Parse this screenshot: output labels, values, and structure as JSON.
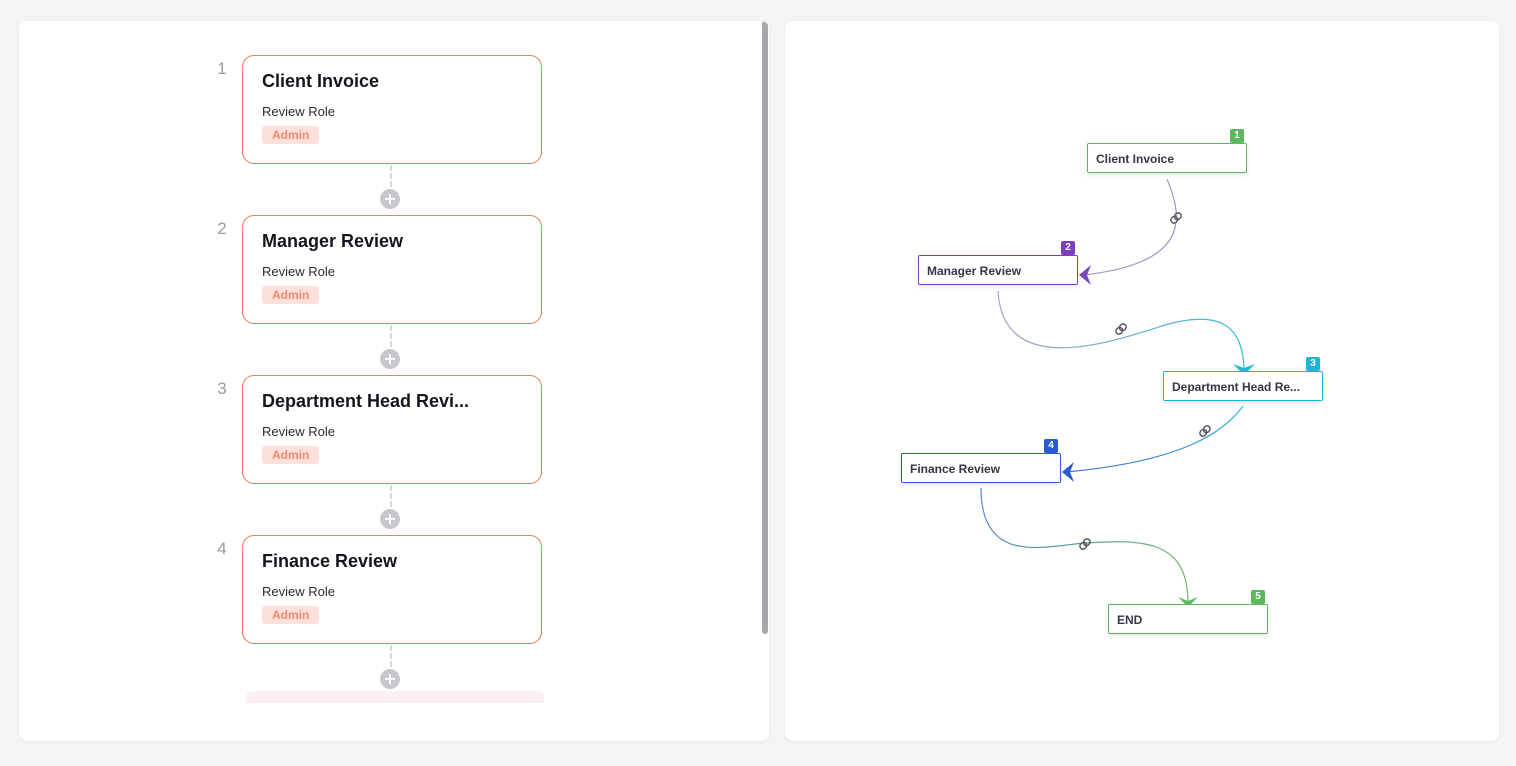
{
  "steps_panel": {
    "steps": [
      {
        "number": "1",
        "title": "Client Invoice",
        "role_label": "Review Role",
        "role": "Admin"
      },
      {
        "number": "2",
        "title": "Manager Review",
        "role_label": "Review Role",
        "role": "Admin"
      },
      {
        "number": "3",
        "title": "Department Head Revi...",
        "role_label": "Review Role",
        "role": "Admin"
      },
      {
        "number": "4",
        "title": "Finance Review",
        "role_label": "Review Role",
        "role": "Admin"
      }
    ]
  },
  "flow_panel": {
    "nodes": [
      {
        "number": "1",
        "label": "Client Invoice",
        "color": "#5cb85c"
      },
      {
        "number": "2",
        "label": "Manager Review",
        "color": "#7b3fbf"
      },
      {
        "number": "3",
        "label": "Department Head Re...",
        "color": "#1eb6d6"
      },
      {
        "number": "4",
        "label": "Finance Review",
        "color": "#2a5bd7"
      },
      {
        "number": "5",
        "label": "END",
        "color": "#5cb85c"
      }
    ],
    "link_icon": "link-icon",
    "add_icon": "plus-icon"
  },
  "colors": {
    "card_border": "#ee7c66",
    "badge_bg": "#fde0da",
    "badge_text": "#ef8a73"
  }
}
